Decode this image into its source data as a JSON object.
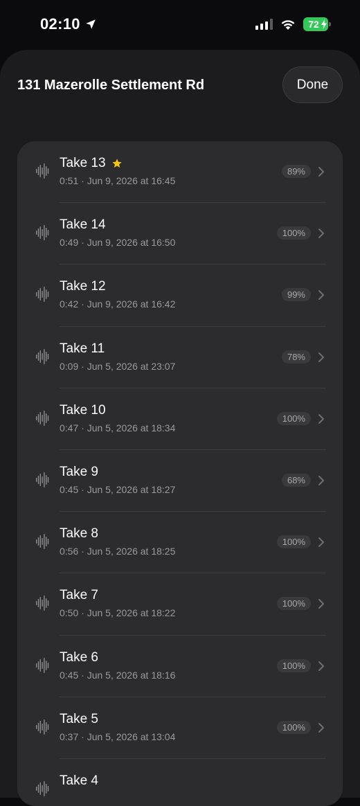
{
  "status_bar": {
    "time": "02:10",
    "battery": "72"
  },
  "sheet": {
    "title": "131 Mazerolle Settlement Rd",
    "done_label": "Done"
  },
  "takes": [
    {
      "title": "Take 13",
      "starred": true,
      "subtitle": "0:51 · Jun 9, 2026 at 16:45",
      "percent": "89%"
    },
    {
      "title": "Take 14",
      "starred": false,
      "subtitle": "0:49 · Jun 9, 2026 at 16:50",
      "percent": "100%"
    },
    {
      "title": "Take 12",
      "starred": false,
      "subtitle": "0:42 · Jun 9, 2026 at 16:42",
      "percent": "99%"
    },
    {
      "title": "Take 11",
      "starred": false,
      "subtitle": "0:09 · Jun 5, 2026 at 23:07",
      "percent": "78%"
    },
    {
      "title": "Take 10",
      "starred": false,
      "subtitle": "0:47 · Jun 5, 2026 at 18:34",
      "percent": "100%"
    },
    {
      "title": "Take 9",
      "starred": false,
      "subtitle": "0:45 · Jun 5, 2026 at 18:27",
      "percent": "68%"
    },
    {
      "title": "Take 8",
      "starred": false,
      "subtitle": "0:56 · Jun 5, 2026 at 18:25",
      "percent": "100%"
    },
    {
      "title": "Take 7",
      "starred": false,
      "subtitle": "0:50 · Jun 5, 2026 at 18:22",
      "percent": "100%"
    },
    {
      "title": "Take 6",
      "starred": false,
      "subtitle": "0:45 · Jun 5, 2026 at 18:16",
      "percent": "100%"
    },
    {
      "title": "Take 5",
      "starred": false,
      "subtitle": "0:37 · Jun 5, 2026 at 13:04",
      "percent": "100%"
    },
    {
      "title": "Take 4",
      "starred": false,
      "subtitle": "",
      "percent": ""
    }
  ],
  "colors": {
    "background": "#0b0b0d",
    "sheet": "#1c1c1e",
    "card": "#2c2c2e",
    "battery": "#34c759",
    "star": "#f5c518"
  },
  "icons": [
    "location-arrow-icon",
    "cellular-signal-icon",
    "wifi-icon",
    "battery-icon",
    "waveform-icon",
    "star-icon",
    "chevron-right-icon"
  ]
}
